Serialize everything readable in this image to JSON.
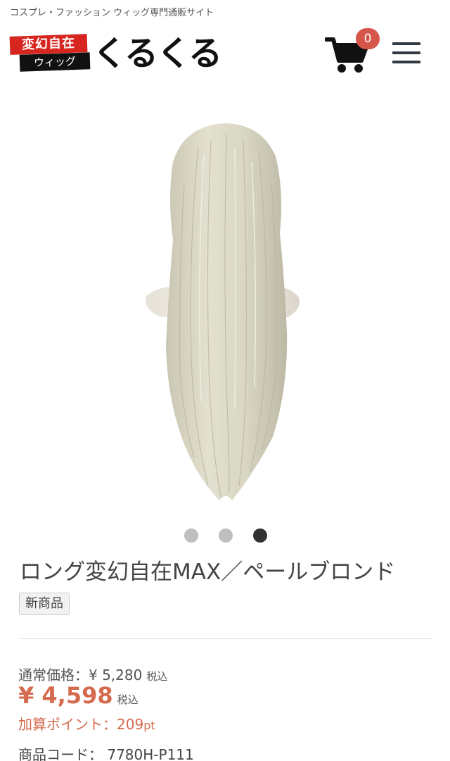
{
  "header": {
    "tagline": "コスプレ・ファッション ウィッグ専門通販サイト",
    "logo": {
      "badge_top": "変幻自在",
      "badge_bottom": "ウィッグ",
      "main": "くるくる"
    },
    "cart": {
      "icon": "cart-icon",
      "count": "0"
    },
    "menu_icon": "hamburger-menu-icon"
  },
  "gallery": {
    "image": "long-straight-pale-blonde-wig-on-mannequin",
    "slides": 3,
    "active_slide": 3
  },
  "product": {
    "title": "ロング変幻自在MAX／ペールブロンド",
    "badge": "新商品",
    "regular_price_label": "通常価格：¥ 5,280",
    "regular_price_tax": "税込",
    "sale_price": "¥ 4,598",
    "sale_price_tax": "税込",
    "points_label": "加算ポイント：209",
    "points_unit": "pt",
    "code_label": "商品コード：",
    "code_value": "7780H-P111"
  },
  "colors": {
    "accent": "#d46a4e",
    "badge_red": "#d6564a",
    "logo_red": "#d6261f",
    "hair": "#d8d5c4"
  }
}
